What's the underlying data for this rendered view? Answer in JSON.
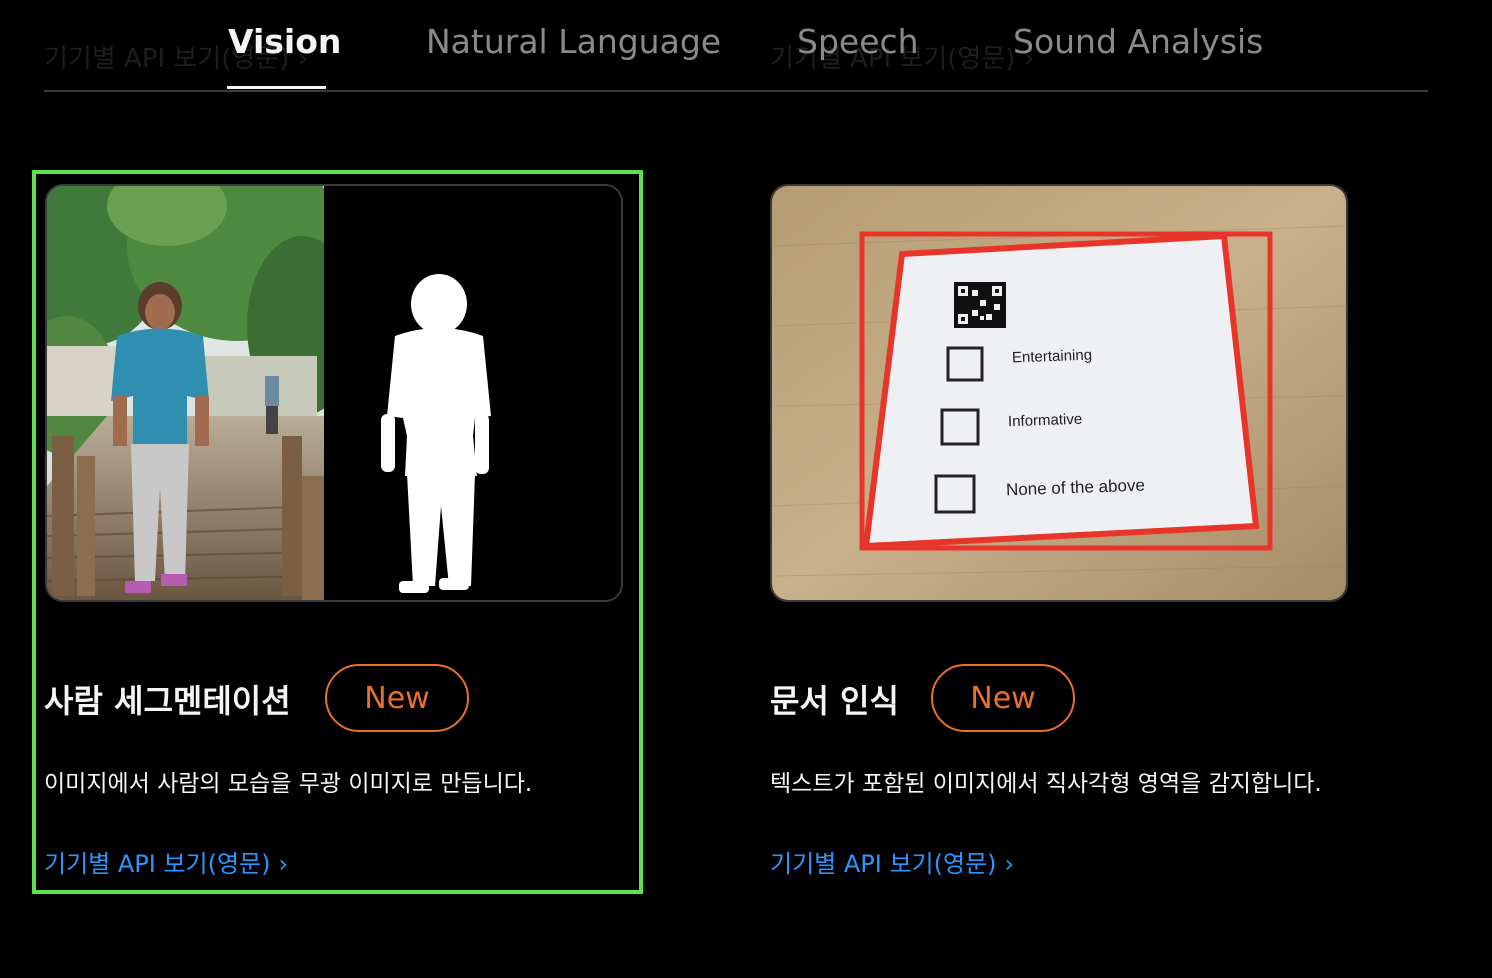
{
  "tabs": [
    {
      "label": "Vision",
      "active": true
    },
    {
      "label": "Natural Language",
      "active": false
    },
    {
      "label": "Speech",
      "active": false
    },
    {
      "label": "Sound Analysis",
      "active": false
    }
  ],
  "background_links": [
    "기기별 API 보기(영문) ›",
    "기기별 API 보기(영문) ›"
  ],
  "cards": [
    {
      "title": "사람 세그멘테이션",
      "badge": "New",
      "description": "이미지에서 사람의 모습을 무광 이미지로 만듭니다.",
      "link": "기기별 API 보기(영문)",
      "link_chevron": "›",
      "selected": true
    },
    {
      "title": "문서 인식",
      "badge": "New",
      "description": "텍스트가 포함된 이미지에서 직사각형 영역을 감지합니다.",
      "link": "기기별 API 보기(영문)",
      "link_chevron": "›",
      "selected": false
    }
  ],
  "document_image": {
    "options": [
      "Entertaining",
      "Informative",
      "None of the above"
    ]
  },
  "colors": {
    "background": "#000000",
    "accent_link": "#2997ff",
    "badge": "#e96f2c",
    "selection": "#5de14f",
    "detection_box": "#e8352a"
  }
}
